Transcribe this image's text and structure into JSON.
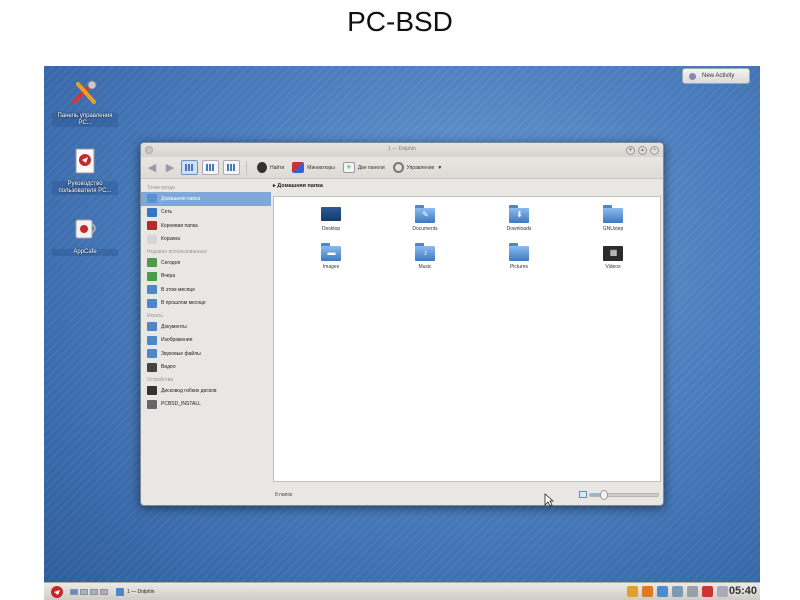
{
  "slide": {
    "title": "PC-BSD"
  },
  "desktop": {
    "icons": [
      {
        "label": "Панель управления PC...",
        "icon": "control-panel-icon"
      },
      {
        "label": "Руководство пользователя PC...",
        "icon": "handbook-icon"
      },
      {
        "label": "AppCafe",
        "icon": "appcafe-icon"
      }
    ],
    "new_activity": "New Activity"
  },
  "window": {
    "title": "1 — Dolphin",
    "toolbar": {
      "find": "Найти",
      "preview": "Миниатюры",
      "split": "Две панели",
      "control": "Управление"
    },
    "breadcrumb": "Домашняя папка",
    "sidebar": {
      "sections": [
        {
          "title": "Точки входа",
          "items": [
            {
              "label": "Домашняя папка",
              "selected": true,
              "color": "#5a8fd0"
            },
            {
              "label": "Сеть",
              "color": "#3a74c2"
            },
            {
              "label": "Корневая папка",
              "color": "#b82a2a"
            },
            {
              "label": "Корзина",
              "color": "#d6d6d6"
            }
          ]
        },
        {
          "title": "Недавно использованные",
          "items": [
            {
              "label": "Сегодня",
              "color": "#4b9b4b"
            },
            {
              "label": "Вчера",
              "color": "#4b9b4b"
            },
            {
              "label": "В этом месяце",
              "color": "#4f86c6"
            },
            {
              "label": "В прошлом месяце",
              "color": "#4f86c6"
            }
          ]
        },
        {
          "title": "Искать",
          "items": [
            {
              "label": "Документы",
              "color": "#4f86c6"
            },
            {
              "label": "Изображения",
              "color": "#4f86c6"
            },
            {
              "label": "Звуковые файлы",
              "color": "#4f86c6"
            },
            {
              "label": "Видео",
              "color": "#444444"
            }
          ]
        },
        {
          "title": "Устройства",
          "items": [
            {
              "label": "Дисковод гибких дисков",
              "color": "#333333"
            },
            {
              "label": "PCBSD_INSTALL",
              "color": "#666666"
            }
          ]
        }
      ]
    },
    "files": [
      {
        "name": "Desktop",
        "kind": "desktop"
      },
      {
        "name": "Documents",
        "kind": "folder",
        "emblem": "✎"
      },
      {
        "name": "Downloads",
        "kind": "folder",
        "emblem": "⬇"
      },
      {
        "name": "GNUstep",
        "kind": "folder",
        "emblem": ""
      },
      {
        "name": "Images",
        "kind": "folder",
        "emblem": "▬"
      },
      {
        "name": "Music",
        "kind": "folder",
        "emblem": "♪"
      },
      {
        "name": "Pictures",
        "kind": "folder",
        "emblem": ""
      },
      {
        "name": "Videos",
        "kind": "video",
        "emblem": "▦"
      }
    ],
    "status": {
      "count": "8 папок",
      "zoom_percent": 20
    }
  },
  "taskbar": {
    "task": "1 — Dolphin",
    "clock": "05:40",
    "tray_colors": [
      "#e0a030",
      "#e07a20",
      "#4b8bd0",
      "#7a9ab8",
      "#9aa0a8",
      "#c33",
      "#aab"
    ]
  }
}
